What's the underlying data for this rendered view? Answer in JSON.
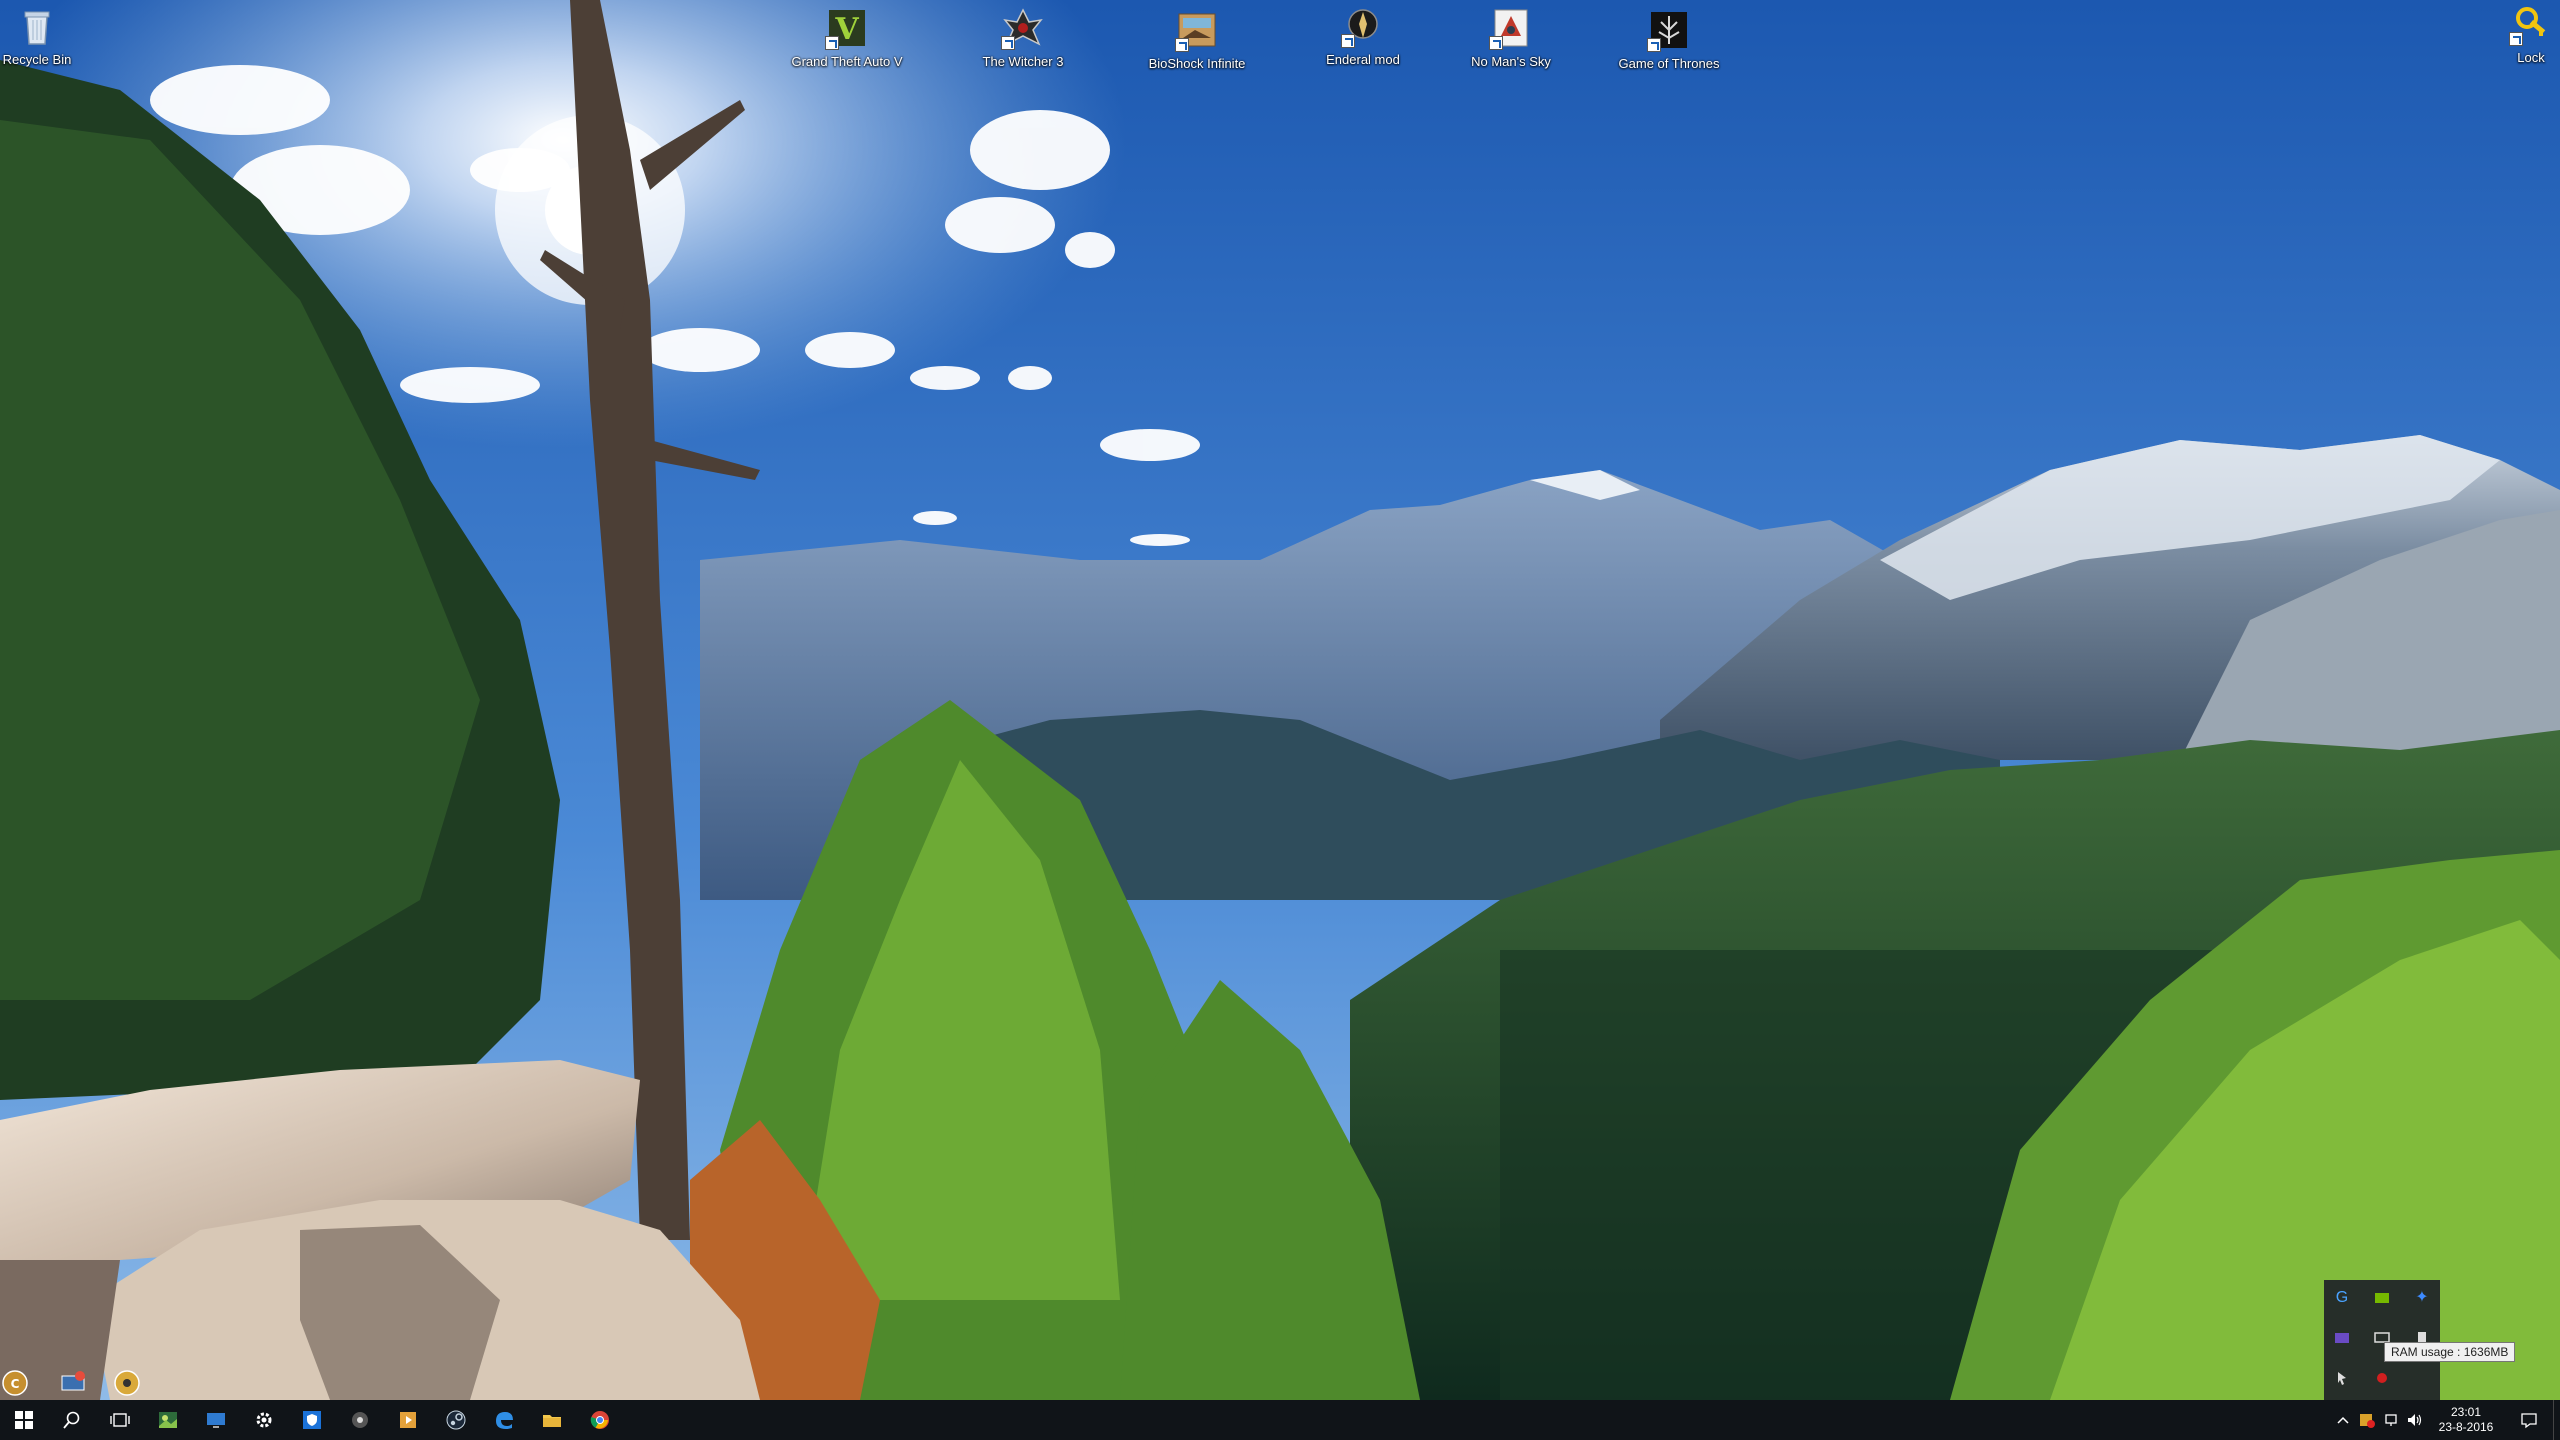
{
  "desktop": {
    "icons": [
      {
        "id": "recycle-bin",
        "label": "Recycle Bin",
        "icon": "recycle-bin-icon"
      },
      {
        "id": "gta5",
        "label": "Grand Theft Auto V",
        "icon": "gta-icon"
      },
      {
        "id": "witcher3",
        "label": "The Witcher 3",
        "icon": "witcher-icon"
      },
      {
        "id": "bioshock",
        "label": "BioShock Infinite",
        "icon": "bioshock-icon"
      },
      {
        "id": "enderal",
        "label": "Enderal mod",
        "icon": "enderal-icon"
      },
      {
        "id": "nms",
        "label": "No Man's Sky",
        "icon": "no-mans-sky-icon"
      },
      {
        "id": "got",
        "label": "Game of Thrones",
        "icon": "game-of-thrones-icon"
      },
      {
        "id": "lock",
        "label": "Lock",
        "icon": "lock-icon"
      }
    ]
  },
  "tray_flyout": {
    "tooltip": "RAM usage : 1636MB"
  },
  "taskbar": {
    "pinned": [
      "start-icon",
      "search-icon",
      "task-view-icon",
      "photo-app-icon",
      "remote-desktop-icon",
      "settings-icon",
      "windows-defender-icon",
      "witcher-app-icon",
      "media-player-icon",
      "steam-icon",
      "edge-icon",
      "file-explorer-icon",
      "chrome-icon"
    ],
    "clock": {
      "time": "23:01",
      "date": "23-8-2016"
    }
  },
  "colors": {
    "taskbar": "#101418",
    "sky_top": "#1e5eb8",
    "sky_bottom": "#6fa6df"
  }
}
